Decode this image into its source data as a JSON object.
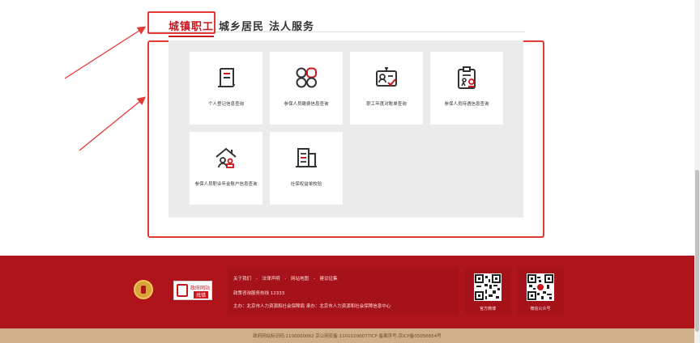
{
  "tabs": [
    {
      "label": "城镇职工",
      "active": true
    },
    {
      "label": "城乡居民",
      "active": false
    },
    {
      "label": "法人服务",
      "active": false
    }
  ],
  "services": [
    {
      "label": "个人登记信息查询",
      "icon": "scroll-document-icon"
    },
    {
      "label": "参保人员缴费信息查询",
      "icon": "grid-nodes-icon"
    },
    {
      "label": "职工年度对账单查询",
      "icon": "id-card-check-icon"
    },
    {
      "label": "参保人员待遇信息查询",
      "icon": "clipboard-person-icon"
    },
    {
      "label": "参保人员职业年金账户信息查询",
      "icon": "house-people-icon"
    },
    {
      "label": "社保权益单校验",
      "icon": "building-icon"
    }
  ],
  "footer": {
    "links": [
      "关于我们",
      "-",
      "法律声明",
      "-",
      "网站地图",
      "-",
      "建议征集"
    ],
    "hotline": "政策咨询服务热线 12333",
    "host": "主办：北京市人力资源和社会保障局 承办：北京市人力资源和社会保障信息中心",
    "gov_badge_top": "政府网站",
    "gov_badge_bottom": "找错",
    "qr": [
      {
        "caption": "官方微博"
      },
      {
        "caption": "微信公众号"
      }
    ],
    "record": "政府网站标识码:1100000062   京公网安备:11010200077ICP   备案序号:京ICP备05056854号"
  },
  "colors": {
    "accent": "#c8161d",
    "footer_bg": "#b0141b",
    "annotation": "#e53935"
  }
}
